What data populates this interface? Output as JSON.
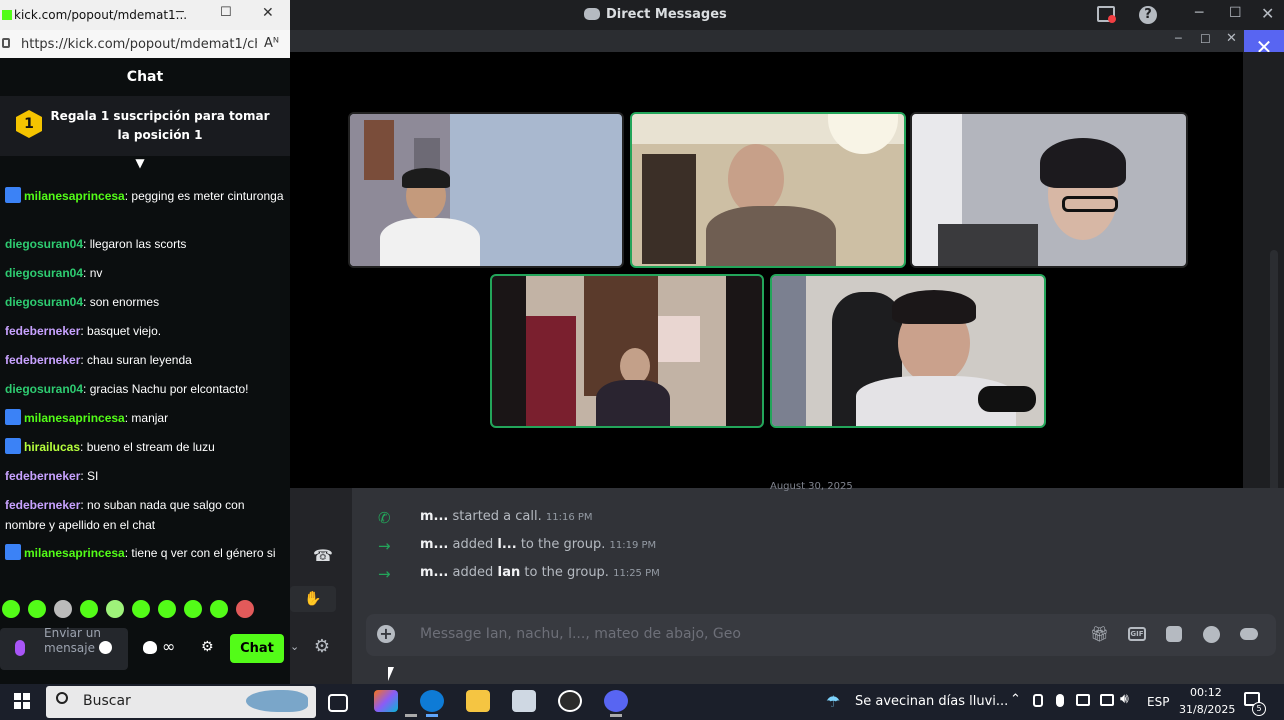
{
  "kick": {
    "window_title": "kick.com/popout/mdemat1...",
    "url": "https://kick.com/popout/mdemat1/chat",
    "reader_icon": "Aᴺ",
    "header": "Chat",
    "sub_banner": {
      "badge": "1",
      "text": "Regala 1 suscripción para tomar la posición 1"
    },
    "messages": [
      {
        "user": "milanesaprincesa",
        "text": ": pegging es meter cinturonga",
        "color": "#53fc18",
        "badge": true
      },
      {
        "user": "diegosuran04",
        "text": ": llegaron las scorts",
        "color": "#2ecc71",
        "badge": false
      },
      {
        "user": "diegosuran04",
        "text": ": nv",
        "color": "#2ecc71",
        "badge": false
      },
      {
        "user": "diegosuran04",
        "text": ": son enormes",
        "color": "#2ecc71",
        "badge": false
      },
      {
        "user": "fedeberneker",
        "text": ": basquet viejo.",
        "color": "#c8a2ff",
        "badge": false
      },
      {
        "user": "fedeberneker",
        "text": ": chau suran leyenda",
        "color": "#c8a2ff",
        "badge": false
      },
      {
        "user": "diegosuran04",
        "text": ": gracias Nachu por elcontacto!",
        "color": "#2ecc71",
        "badge": false
      },
      {
        "user": "milanesaprincesa",
        "text": ": manjar",
        "color": "#53fc18",
        "badge": true
      },
      {
        "user": "hirailucas",
        "text": ": bueno el stream de luzu",
        "color": "#b6ff3d",
        "badge": true
      },
      {
        "user": "fedeberneker",
        "text": ": SI",
        "color": "#c8a2ff",
        "badge": false
      },
      {
        "user": "fedeberneker",
        "text": ": no suban nada que salgo con nombre y apellido en el chat",
        "color": "#c8a2ff",
        "badge": false
      },
      {
        "user": "milanesaprincesa",
        "text": ": tiene q ver con el género si",
        "color": "#53fc18",
        "badge": true
      }
    ],
    "input_placeholder": "Enviar un mensaje",
    "infinity": "∞",
    "chat_button": "Chat"
  },
  "discord": {
    "window_title": "Direct Messages",
    "date_divider": "August 30, 2025",
    "messages": [
      {
        "icon": "phone-icon",
        "user": "m...",
        "text": "started a call.",
        "target": "",
        "suffix": "",
        "time": "11:16 PM"
      },
      {
        "icon": "arrow-right-icon",
        "user": "m...",
        "text": "added",
        "target": "l...",
        "suffix": "to the group.",
        "time": "11:19 PM"
      },
      {
        "icon": "arrow-right-icon",
        "user": "m...",
        "text": "added",
        "target": "Ian",
        "suffix": "to the group.",
        "time": "11:25 PM"
      }
    ],
    "composer_placeholder": "Message Ian, nachu, l..., mateo de abajo, Geo",
    "composer_icons": [
      "gift-icon",
      "gif-icon",
      "sticker-icon",
      "emoji-icon",
      "game-icon"
    ],
    "accent_color": "#5865f2",
    "speaking_color": "#23a55a"
  },
  "taskbar": {
    "search_placeholder": "Buscar",
    "weather": "Se avecinan días lluvi...",
    "language": "ESP",
    "time": "00:12",
    "date": "31/8/2025",
    "notification_count": "5"
  }
}
